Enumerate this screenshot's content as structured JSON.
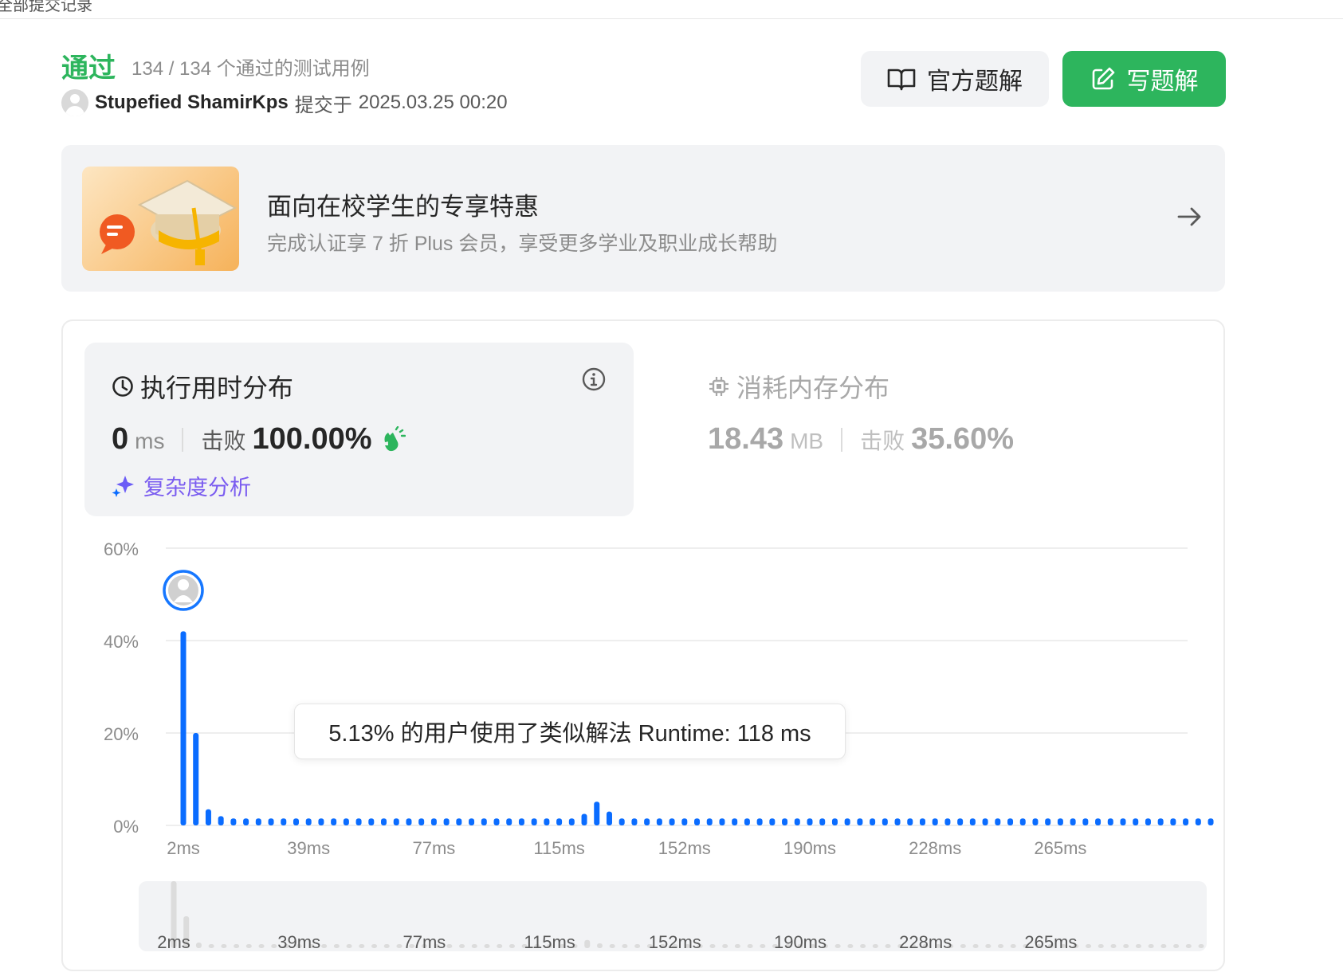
{
  "topbar": {
    "breadcrumb": "全部提交记录",
    "corner": ""
  },
  "header": {
    "status": "通过",
    "cases_passed": "134 / 134 个通过的测试用例",
    "username": "Stupefied ShamirKps",
    "submitted_at_label": "提交于",
    "submitted_at": "2025.03.25 00:20",
    "official_solution_label": "官方题解",
    "write_solution_label": "写题解"
  },
  "promo": {
    "title": "面向在校学生的专享特惠",
    "subtitle": "完成认证享 7 折 Plus 会员，享受更多学业及职业成长帮助"
  },
  "runtime": {
    "title": "执行用时分布",
    "value": "0",
    "unit": "ms",
    "beat_label": "击败",
    "beat_value": "100.00%",
    "complexity_label": "复杂度分析"
  },
  "memory": {
    "title": "消耗内存分布",
    "value": "18.43",
    "unit": "MB",
    "beat_label": "击败",
    "beat_value": "35.60%"
  },
  "tooltip": {
    "text": "5.13% 的用户使用了类似解法 Runtime: 118 ms"
  },
  "colors": {
    "accent_green": "#2db55d",
    "bar_blue": "#0a6cff",
    "purple": "#7a5cf0"
  },
  "chart_data": {
    "type": "bar",
    "ylabel": "",
    "xlabel": "",
    "yticks": [
      "0%",
      "20%",
      "40%",
      "60%"
    ],
    "ylim": [
      0,
      60
    ],
    "xticks": [
      "2ms",
      "39ms",
      "77ms",
      "115ms",
      "152ms",
      "190ms",
      "228ms",
      "265ms"
    ],
    "values": [
      42,
      20,
      3.5,
      2,
      1.5,
      1.5,
      1.5,
      1.5,
      1.5,
      1.5,
      1.5,
      1.5,
      1.5,
      1.5,
      1.5,
      1.5,
      1.5,
      1.5,
      1.5,
      1.5,
      1.5,
      1.5,
      1.5,
      1.5,
      1.5,
      1.5,
      1.5,
      1.5,
      1.5,
      1.5,
      1.5,
      1.5,
      2.5,
      5.13,
      3,
      1.5,
      1.5,
      1.5,
      1.5,
      1.5,
      1.5,
      1.5,
      1.5,
      1.5,
      1.5,
      1.5,
      1.5,
      1.5,
      1.5,
      1.5,
      1.5,
      1.5,
      1.5,
      1.5,
      1.5,
      1.5,
      1.5,
      1.5,
      1.5,
      1.5,
      1.5,
      1.5,
      1.5,
      1.5,
      1.5,
      1.5,
      1.5,
      1.5,
      1.5,
      1.5,
      1.5,
      1.5,
      1.5,
      1.5,
      1.5,
      1.5,
      1.5,
      1.5,
      1.5,
      1.5,
      1.5,
      1.5,
      1.5
    ],
    "highlight_index": 0,
    "grid": true
  }
}
